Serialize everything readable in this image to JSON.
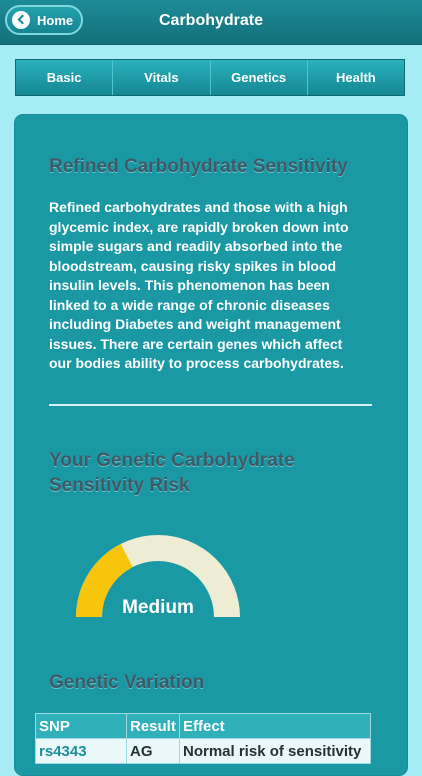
{
  "header": {
    "title": "Carbohydrate",
    "home_label": "Home"
  },
  "tabs": [
    "Basic",
    "Vitals",
    "Genetics",
    "Health"
  ],
  "section1": {
    "title": "Refined Carbohydrate Sensitivity",
    "body": "Refined carbohydrates and those with a high glycemic index, are rapidly broken down into simple sugars and readily absorbed into the bloodstream, causing risky spikes in blood insulin levels. This phenomenon has been linked to a wide range of chronic diseases including Diabetes and weight management issues. There are certain genes which affect our bodies ability to process carbohydrates."
  },
  "risk": {
    "title": "Your Genetic Carbohydrate Sensitivity Risk",
    "level": "Medium",
    "level_fraction": 0.35,
    "colors": {
      "filled": "#f7c60c",
      "track": "#ededd3"
    }
  },
  "variation": {
    "title": "Genetic Variation",
    "headers": [
      "SNP",
      "Result",
      "Effect"
    ],
    "rows": [
      [
        "rs4343",
        "AG",
        "Normal risk of sensitivity"
      ]
    ]
  }
}
